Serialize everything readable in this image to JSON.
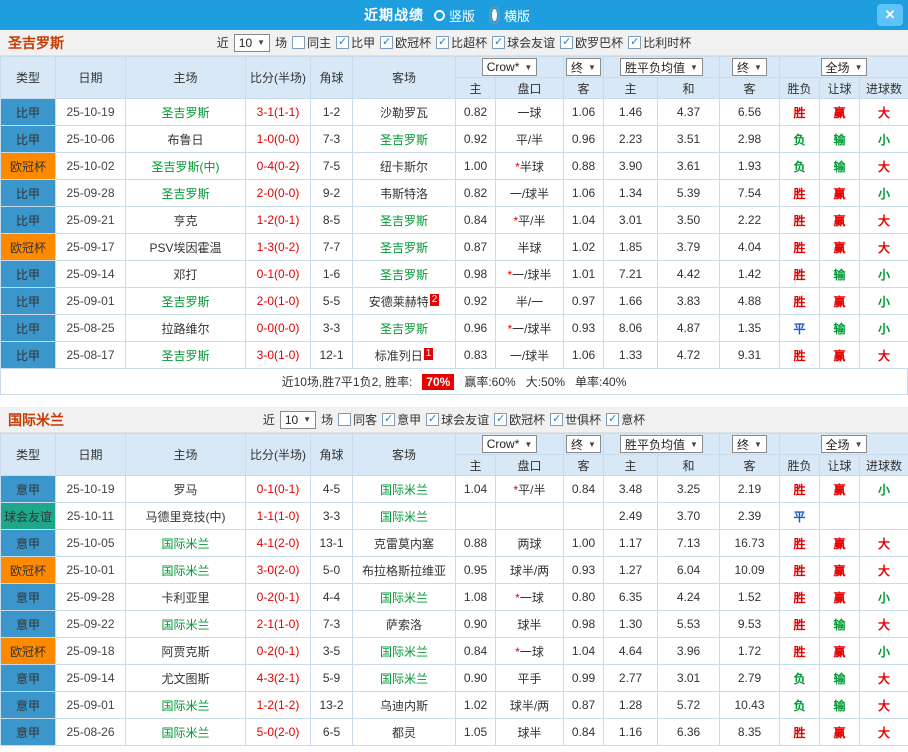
{
  "header": {
    "title": "近期战绩",
    "radios": [
      {
        "label": "竖版",
        "selected": false
      },
      {
        "label": "横版",
        "selected": true
      }
    ],
    "close_label": "✕"
  },
  "colors": {
    "topbar": "#1e9ede",
    "close_btn": "#5ec2f5",
    "section_title": "#c53b00",
    "header_bg": "#d9e8f6",
    "border": "#c9dcee",
    "focus_team": "#009933",
    "plain_team": "#333333",
    "score": "#e60000",
    "asterisk": "#e60000",
    "badge_bg": "#e60000",
    "rate_bg": "#e60000",
    "league": {
      "比甲": "#3a96cb",
      "意甲": "#3a96cb",
      "欧冠杯": "#ff8a00",
      "球会友谊": "#1fa78c"
    },
    "result": {
      "胜": "#e60000",
      "负": "#009933",
      "平": "#2255cc",
      "赢": "#e60000",
      "输": "#009933",
      "大": "#e60000",
      "小": "#009933"
    }
  },
  "sections": [
    {
      "team": "圣吉罗斯",
      "filter": {
        "prefix": "近",
        "count": "10",
        "suffix": "场",
        "checkboxes": [
          {
            "label": "同主",
            "checked": false
          },
          {
            "label": "比甲",
            "checked": true
          },
          {
            "label": "欧冠杯",
            "checked": true
          },
          {
            "label": "比超杯",
            "checked": true
          },
          {
            "label": "球会友谊",
            "checked": true
          },
          {
            "label": "欧罗巴杯",
            "checked": true
          },
          {
            "label": "比利时杯",
            "checked": true
          }
        ]
      },
      "table": {
        "col_headers": [
          "类型",
          "日期",
          "主场",
          "比分(半场)",
          "角球",
          "客场"
        ],
        "selects": [
          "Crow*",
          "终",
          "胜平负均值",
          "终",
          "全场"
        ],
        "sub_headers": [
          "主",
          "盘口",
          "客",
          "主",
          "和",
          "客",
          "胜负",
          "让球",
          "进球数"
        ]
      },
      "rows": [
        {
          "type": "比甲",
          "date": "25-10-19",
          "home": "圣吉罗斯",
          "home_focus": true,
          "score": "3-1(1-1)",
          "corner": "1-2",
          "away": "沙勒罗瓦",
          "odds_home": "0.82",
          "handicap": "一球",
          "odds_away": "1.06",
          "avg_win": "1.46",
          "avg_draw": "4.37",
          "avg_lose": "6.56",
          "result": "胜",
          "handicap_result": "赢",
          "goals": "大"
        },
        {
          "type": "比甲",
          "date": "25-10-06",
          "home": "布鲁日",
          "score": "1-0(0-0)",
          "corner": "7-3",
          "away": "圣吉罗斯",
          "away_focus": true,
          "odds_home": "0.92",
          "handicap": "平/半",
          "odds_away": "0.96",
          "avg_win": "2.23",
          "avg_draw": "3.51",
          "avg_lose": "2.98",
          "result": "负",
          "handicap_result": "输",
          "goals": "小"
        },
        {
          "type": "欧冠杯",
          "date": "25-10-02",
          "home": "圣吉罗斯(中)",
          "home_focus": true,
          "score": "0-4(0-2)",
          "corner": "7-5",
          "away": "纽卡斯尔",
          "odds_home": "1.00",
          "handicap": "*半球",
          "odds_away": "0.88",
          "avg_win": "3.90",
          "avg_draw": "3.61",
          "avg_lose": "1.93",
          "result": "负",
          "handicap_result": "输",
          "goals": "大"
        },
        {
          "type": "比甲",
          "date": "25-09-28",
          "home": "圣吉罗斯",
          "home_focus": true,
          "score": "2-0(0-0)",
          "corner": "9-2",
          "away": "韦斯特洛",
          "odds_home": "0.82",
          "handicap": "一/球半",
          "odds_away": "1.06",
          "avg_win": "1.34",
          "avg_draw": "5.39",
          "avg_lose": "7.54",
          "result": "胜",
          "handicap_result": "赢",
          "goals": "小"
        },
        {
          "type": "比甲",
          "date": "25-09-21",
          "home": "亨克",
          "score": "1-2(0-1)",
          "corner": "8-5",
          "away": "圣吉罗斯",
          "away_focus": true,
          "odds_home": "0.84",
          "handicap": "*平/半",
          "odds_away": "1.04",
          "avg_win": "3.01",
          "avg_draw": "3.50",
          "avg_lose": "2.22",
          "result": "胜",
          "handicap_result": "赢",
          "goals": "大"
        },
        {
          "type": "欧冠杯",
          "date": "25-09-17",
          "home": "PSV埃因霍温",
          "score": "1-3(0-2)",
          "corner": "7-7",
          "away": "圣吉罗斯",
          "away_focus": true,
          "odds_home": "0.87",
          "handicap": "半球",
          "odds_away": "1.02",
          "avg_win": "1.85",
          "avg_draw": "3.79",
          "avg_lose": "4.04",
          "result": "胜",
          "handicap_result": "赢",
          "goals": "大"
        },
        {
          "type": "比甲",
          "date": "25-09-14",
          "home": "邓打",
          "score": "0-1(0-0)",
          "corner": "1-6",
          "away": "圣吉罗斯",
          "away_focus": true,
          "odds_home": "0.98",
          "handicap": "*一/球半",
          "odds_away": "1.01",
          "avg_win": "7.21",
          "avg_draw": "4.42",
          "avg_lose": "1.42",
          "result": "胜",
          "handicap_result": "输",
          "goals": "小"
        },
        {
          "type": "比甲",
          "date": "25-09-01",
          "home": "圣吉罗斯",
          "home_focus": true,
          "score": "2-0(1-0)",
          "corner": "5-5",
          "away": "安德莱赫特",
          "away_badge": "2",
          "odds_home": "0.92",
          "handicap": "半/一",
          "odds_away": "0.97",
          "avg_win": "1.66",
          "avg_draw": "3.83",
          "avg_lose": "4.88",
          "result": "胜",
          "handicap_result": "赢",
          "goals": "小"
        },
        {
          "type": "比甲",
          "date": "25-08-25",
          "home": "拉路维尔",
          "score": "0-0(0-0)",
          "corner": "3-3",
          "away": "圣吉罗斯",
          "away_focus": true,
          "odds_home": "0.96",
          "handicap": "*一/球半",
          "odds_away": "0.93",
          "avg_win": "8.06",
          "avg_draw": "4.87",
          "avg_lose": "1.35",
          "result": "平",
          "handicap_result": "输",
          "goals": "小"
        },
        {
          "type": "比甲",
          "date": "25-08-17",
          "home": "圣吉罗斯",
          "home_focus": true,
          "score": "3-0(1-0)",
          "corner": "12-1",
          "away": "标准列日",
          "away_badge": "1",
          "odds_home": "0.83",
          "handicap": "一/球半",
          "odds_away": "1.06",
          "avg_win": "1.33",
          "avg_draw": "4.72",
          "avg_lose": "9.31",
          "result": "胜",
          "handicap_result": "赢",
          "goals": "大"
        }
      ],
      "summary": {
        "text_before": "近10场,胜7平1负2, 胜率:",
        "win_rate": "70%",
        "parts": [
          "赢率:60%",
          "大:50%",
          "单率:40%"
        ]
      }
    },
    {
      "team": "国际米兰",
      "filter": {
        "prefix": "近",
        "count": "10",
        "suffix": "场",
        "checkboxes": [
          {
            "label": "同客",
            "checked": false
          },
          {
            "label": "意甲",
            "checked": true
          },
          {
            "label": "球会友谊",
            "checked": true
          },
          {
            "label": "欧冠杯",
            "checked": true
          },
          {
            "label": "世俱杯",
            "checked": true
          },
          {
            "label": "意杯",
            "checked": true
          }
        ]
      },
      "table": {
        "col_headers": [
          "类型",
          "日期",
          "主场",
          "比分(半场)",
          "角球",
          "客场"
        ],
        "selects": [
          "Crow*",
          "终",
          "胜平负均值",
          "终",
          "全场"
        ],
        "sub_headers": [
          "主",
          "盘口",
          "客",
          "主",
          "和",
          "客",
          "胜负",
          "让球",
          "进球数"
        ]
      },
      "rows": [
        {
          "type": "意甲",
          "date": "25-10-19",
          "home": "罗马",
          "score": "0-1(0-1)",
          "corner": "4-5",
          "away": "国际米兰",
          "away_focus": true,
          "odds_home": "1.04",
          "handicap": "*平/半",
          "odds_away": "0.84",
          "avg_win": "3.48",
          "avg_draw": "3.25",
          "avg_lose": "2.19",
          "result": "胜",
          "handicap_result": "赢",
          "goals": "小"
        },
        {
          "type": "球会友谊",
          "date": "25-10-11",
          "home": "马德里竞技(中)",
          "score": "1-1(1-0)",
          "corner": "3-3",
          "away": "国际米兰",
          "away_focus": true,
          "odds_home": "",
          "handicap": "",
          "odds_away": "",
          "avg_win": "2.49",
          "avg_draw": "3.70",
          "avg_lose": "2.39",
          "result": "平",
          "handicap_result": "",
          "goals": ""
        },
        {
          "type": "意甲",
          "date": "25-10-05",
          "home": "国际米兰",
          "home_focus": true,
          "score": "4-1(2-0)",
          "corner": "13-1",
          "away": "克雷莫内塞",
          "odds_home": "0.88",
          "handicap": "两球",
          "odds_away": "1.00",
          "avg_win": "1.17",
          "avg_draw": "7.13",
          "avg_lose": "16.73",
          "result": "胜",
          "handicap_result": "赢",
          "goals": "大"
        },
        {
          "type": "欧冠杯",
          "date": "25-10-01",
          "home": "国际米兰",
          "home_focus": true,
          "score": "3-0(2-0)",
          "corner": "5-0",
          "away": "布拉格斯拉维亚",
          "odds_home": "0.95",
          "handicap": "球半/两",
          "odds_away": "0.93",
          "avg_win": "1.27",
          "avg_draw": "6.04",
          "avg_lose": "10.09",
          "result": "胜",
          "handicap_result": "赢",
          "goals": "大"
        },
        {
          "type": "意甲",
          "date": "25-09-28",
          "home": "卡利亚里",
          "score": "0-2(0-1)",
          "corner": "4-4",
          "away": "国际米兰",
          "away_focus": true,
          "odds_home": "1.08",
          "handicap": "*一球",
          "odds_away": "0.80",
          "avg_win": "6.35",
          "avg_draw": "4.24",
          "avg_lose": "1.52",
          "result": "胜",
          "handicap_result": "赢",
          "goals": "小"
        },
        {
          "type": "意甲",
          "date": "25-09-22",
          "home": "国际米兰",
          "home_focus": true,
          "score": "2-1(1-0)",
          "corner": "7-3",
          "away": "萨索洛",
          "odds_home": "0.90",
          "handicap": "球半",
          "odds_away": "0.98",
          "avg_win": "1.30",
          "avg_draw": "5.53",
          "avg_lose": "9.53",
          "result": "胜",
          "handicap_result": "输",
          "goals": "大"
        },
        {
          "type": "欧冠杯",
          "date": "25-09-18",
          "home": "阿贾克斯",
          "score": "0-2(0-1)",
          "corner": "3-5",
          "away": "国际米兰",
          "away_focus": true,
          "odds_home": "0.84",
          "handicap": "*一球",
          "odds_away": "1.04",
          "avg_win": "4.64",
          "avg_draw": "3.96",
          "avg_lose": "1.72",
          "result": "胜",
          "handicap_result": "赢",
          "goals": "小"
        },
        {
          "type": "意甲",
          "date": "25-09-14",
          "home": "尤文图斯",
          "score": "4-3(2-1)",
          "corner": "5-9",
          "away": "国际米兰",
          "away_focus": true,
          "odds_home": "0.90",
          "handicap": "平手",
          "odds_away": "0.99",
          "avg_win": "2.77",
          "avg_draw": "3.01",
          "avg_lose": "2.79",
          "result": "负",
          "handicap_result": "输",
          "goals": "大"
        },
        {
          "type": "意甲",
          "date": "25-09-01",
          "home": "国际米兰",
          "home_focus": true,
          "score": "1-2(1-2)",
          "corner": "13-2",
          "away": "乌迪内斯",
          "odds_home": "1.02",
          "handicap": "球半/两",
          "odds_away": "0.87",
          "avg_win": "1.28",
          "avg_draw": "5.72",
          "avg_lose": "10.43",
          "result": "负",
          "handicap_result": "输",
          "goals": "大"
        },
        {
          "type": "意甲",
          "date": "25-08-26",
          "home": "国际米兰",
          "home_focus": true,
          "score": "5-0(2-0)",
          "corner": "6-5",
          "away": "都灵",
          "odds_home": "1.05",
          "handicap": "球半",
          "odds_away": "0.84",
          "avg_win": "1.16",
          "avg_draw": "6.36",
          "avg_lose": "8.35",
          "result": "胜",
          "handicap_result": "赢",
          "goals": "大"
        }
      ]
    }
  ]
}
